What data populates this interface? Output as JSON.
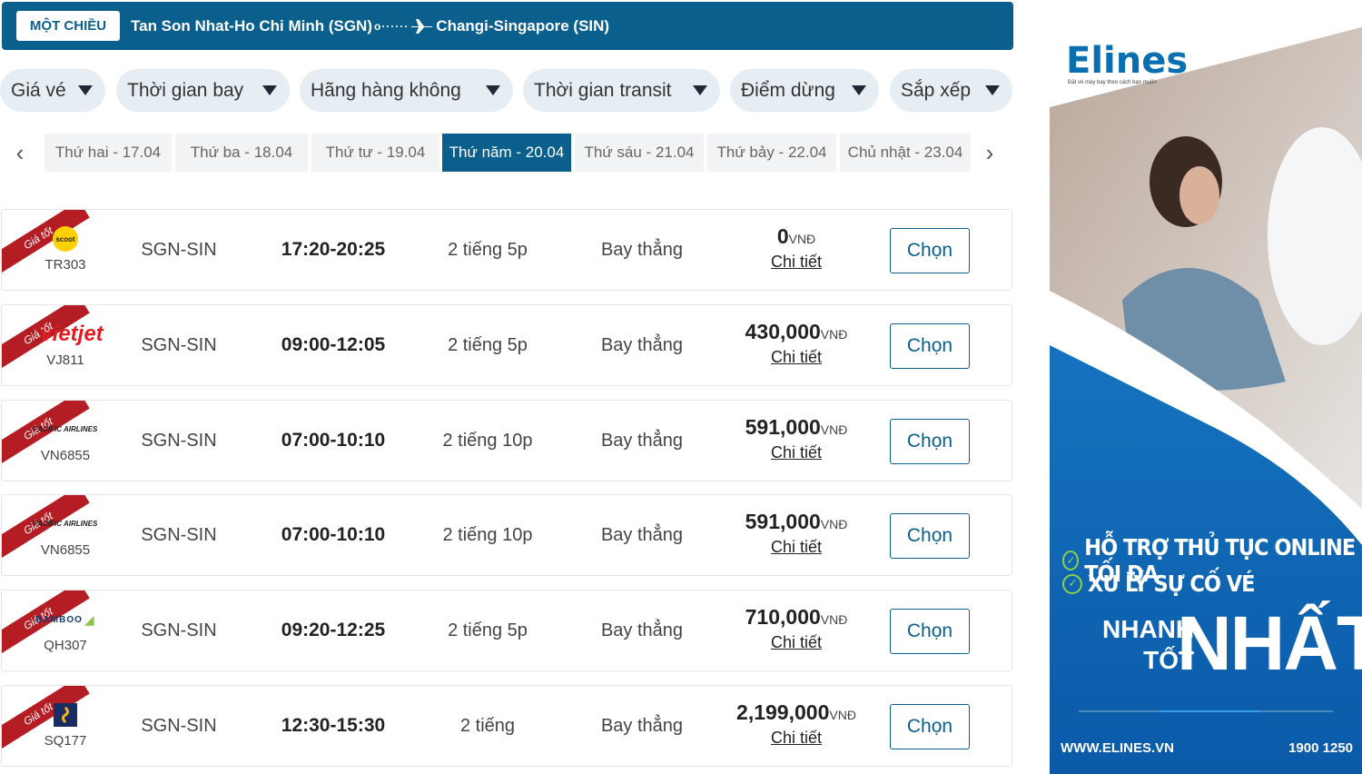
{
  "route": {
    "trip_type": "MỘT CHIỀU",
    "origin": "Tan Son Nhat-Ho Chi Minh (SGN)",
    "destination": "Changi-Singapore (SIN)"
  },
  "filters": [
    {
      "label": "Giá vé"
    },
    {
      "label": "Thời gian bay"
    },
    {
      "label": "Hãng hàng không"
    },
    {
      "label": "Thời gian transit"
    },
    {
      "label": "Điểm dừng"
    },
    {
      "label": "Sắp xếp"
    }
  ],
  "dates": [
    {
      "label": "Thứ hai - 17.04",
      "active": false
    },
    {
      "label": "Thứ ba - 18.04",
      "active": false
    },
    {
      "label": "Thứ tư - 19.04",
      "active": false
    },
    {
      "label": "Thứ năm - 20.04",
      "active": true
    },
    {
      "label": "Thứ sáu - 21.04",
      "active": false
    },
    {
      "label": "Thứ bảy - 22.04",
      "active": false
    },
    {
      "label": "Chủ nhật - 23.04",
      "active": false
    }
  ],
  "flights": [
    {
      "badge": "Giá tốt",
      "airline_logo": "scoot",
      "logo_text": "scoot",
      "code": "TR303",
      "route": "SGN-SIN",
      "time": "17:20-20:25",
      "duration": "2 tiếng 5p",
      "stops": "Bay thẳng",
      "price": "0",
      "currency": "VNĐ",
      "detail": "Chi tiết",
      "choose": "Chọn"
    },
    {
      "badge": "Giá tốt",
      "airline_logo": "vietjet",
      "logo_text": "vietjet",
      "code": "VJ811",
      "route": "SGN-SIN",
      "time": "09:00-12:05",
      "duration": "2 tiếng 5p",
      "stops": "Bay thẳng",
      "price": "430,000",
      "currency": "VNĐ",
      "detail": "Chi tiết",
      "choose": "Chọn"
    },
    {
      "badge": "Giá tốt",
      "airline_logo": "pacific",
      "logo_text": "PACIFIC AIRLINES",
      "code": "VN6855",
      "route": "SGN-SIN",
      "time": "07:00-10:10",
      "duration": "2 tiếng 10p",
      "stops": "Bay thẳng",
      "price": "591,000",
      "currency": "VNĐ",
      "detail": "Chi tiết",
      "choose": "Chọn"
    },
    {
      "badge": "Giá tốt",
      "airline_logo": "pacific",
      "logo_text": "PACIFIC AIRLINES",
      "code": "VN6855",
      "route": "SGN-SIN",
      "time": "07:00-10:10",
      "duration": "2 tiếng 10p",
      "stops": "Bay thẳng",
      "price": "591,000",
      "currency": "VNĐ",
      "detail": "Chi tiết",
      "choose": "Chọn"
    },
    {
      "badge": "Giá tốt",
      "airline_logo": "bamboo",
      "logo_text": "BAMBOO",
      "code": "QH307",
      "route": "SGN-SIN",
      "time": "09:20-12:25",
      "duration": "2 tiếng 5p",
      "stops": "Bay thẳng",
      "price": "710,000",
      "currency": "VNĐ",
      "detail": "Chi tiết",
      "choose": "Chọn"
    },
    {
      "badge": "Giá tốt",
      "airline_logo": "singapore-airlines",
      "logo_text": "",
      "code": "SQ177",
      "route": "SGN-SIN",
      "time": "12:30-15:30",
      "duration": "2 tiếng",
      "stops": "Bay thẳng",
      "price": "2,199,000",
      "currency": "VNĐ",
      "detail": "Chi tiết",
      "choose": "Chọn"
    }
  ],
  "ad": {
    "brand": "Elines",
    "tagline": "Đặt vé máy bay theo cách bạn muốn",
    "line1": "HỖ TRỢ THỦ TỤC ONLINE TỐI ĐA",
    "line2": "XỬ LÝ SỰ CỐ VÉ",
    "fast1": "NHANH",
    "fast2": "TỐT",
    "big": "NHẤT",
    "website": "WWW.ELINES.VN",
    "phone": "1900 1250"
  },
  "colors": {
    "primary": "#0a5f8c",
    "ribbon": "#b51d24",
    "filter_bg": "#e6eef4",
    "ad_blue": "#0a6fb0"
  }
}
